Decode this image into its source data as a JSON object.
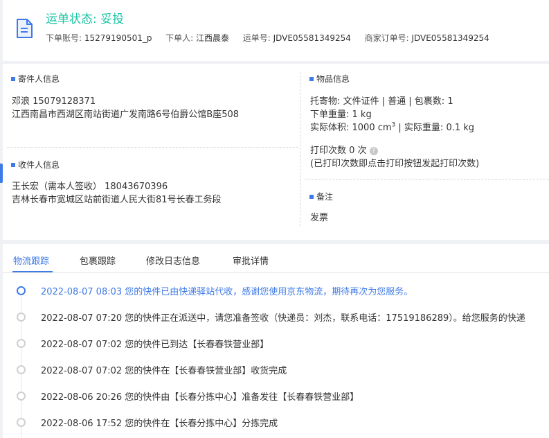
{
  "header": {
    "status_title": "运单状态: 妥投",
    "order_account_label": "下单账号:",
    "order_account": "15279190501_p",
    "orderer_label": "下单人:",
    "orderer": "江西晨泰",
    "waybill_label": "运单号:",
    "waybill": "JDVE05581349254",
    "merchant_order_label": "商家订单号:",
    "merchant_order": "JDVE05581349254"
  },
  "sender": {
    "section_title": "寄件人信息",
    "name_phone": "邓浪    15079128371",
    "address": "江西南昌市西湖区南站街道广发南路6号伯爵公馆B座508"
  },
  "receiver": {
    "section_title": "收件人信息",
    "name_phone": "王长宏（需本人签收）   18043670396",
    "address": "吉林长春市宽城区站前街道人民大街81号长春工务段"
  },
  "goods": {
    "section_title": "物品信息",
    "line1": "托寄物:  文件证件 | 普通  |  包裹数:  1",
    "line2": "下单重量:   1 kg",
    "line3_pre": "实际体积:    1000 cm",
    "line3_sup": "3",
    "line3_post": " | 实际重量:    0.1 kg",
    "print_count": "打印次数    0 次",
    "print_note": "(已打印次数即点击打印按钮发起打印次数)"
  },
  "remarks": {
    "section_title": "备注",
    "text": "发票"
  },
  "tabs": [
    "物流跟踪",
    "包裹跟踪",
    "修改日志信息",
    "审批详情"
  ],
  "timeline": [
    {
      "text": "2022-08-07 08:03 您的快件已由快递驿站代收，感谢您使用京东物流，期待再次为您服务。",
      "active": true
    },
    {
      "text": "2022-08-07 07:20 您的快件正在派送中，请您准备签收（快递员：刘杰，联系电话：17519186289）。给您服务的快递",
      "active": false
    },
    {
      "text": "2022-08-07 07:02 您的快件已到达【长春春铁营业部】",
      "active": false
    },
    {
      "text": "2022-08-07 07:02 您的快件在【长春春铁营业部】收货完成",
      "active": false
    },
    {
      "text": "2022-08-06 20:26 您的快件由【长春分拣中心】准备发往【长春春铁营业部】",
      "active": false
    },
    {
      "text": "2022-08-06 17:52 您的快件在【长春分拣中心】分拣完成",
      "active": false
    }
  ],
  "colors": {
    "accent": "#3e7ae8",
    "status": "#1bc5a4"
  }
}
